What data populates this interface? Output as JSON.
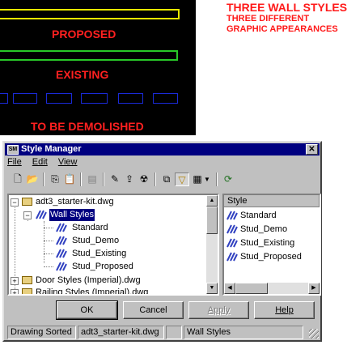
{
  "cad": {
    "labels": {
      "proposed": "PROPOSED",
      "existing": "EXISTING",
      "demolished": "TO BE DEMOLISHED"
    }
  },
  "heading": {
    "title": "THREE WALL STYLES",
    "subtitle_line1": "THREE DIFFERENT",
    "subtitle_line2": "GRAPHIC APPEARANCES"
  },
  "window": {
    "title": "Style Manager",
    "menu": {
      "file": "File",
      "edit": "Edit",
      "view": "View"
    },
    "tree": {
      "drawing": "adt3_starter-kit.dwg",
      "category": "Wall Styles",
      "styles": [
        "Standard",
        "Stud_Demo",
        "Stud_Existing",
        "Stud_Proposed"
      ],
      "door_styles": "Door Styles (Imperial).dwg",
      "railing_styles": "Railing Styles (Imperial).dwg"
    },
    "list": {
      "header": "Style",
      "items": [
        "Standard",
        "Stud_Demo",
        "Stud_Existing",
        "Stud_Proposed"
      ]
    },
    "buttons": {
      "ok": "OK",
      "cancel": "Cancel",
      "apply": "Apply",
      "help": "Help"
    },
    "status": {
      "sort": "Drawing Sorted",
      "drawing": "adt3_starter-kit.dwg",
      "empty": "",
      "category": "Wall Styles"
    }
  }
}
